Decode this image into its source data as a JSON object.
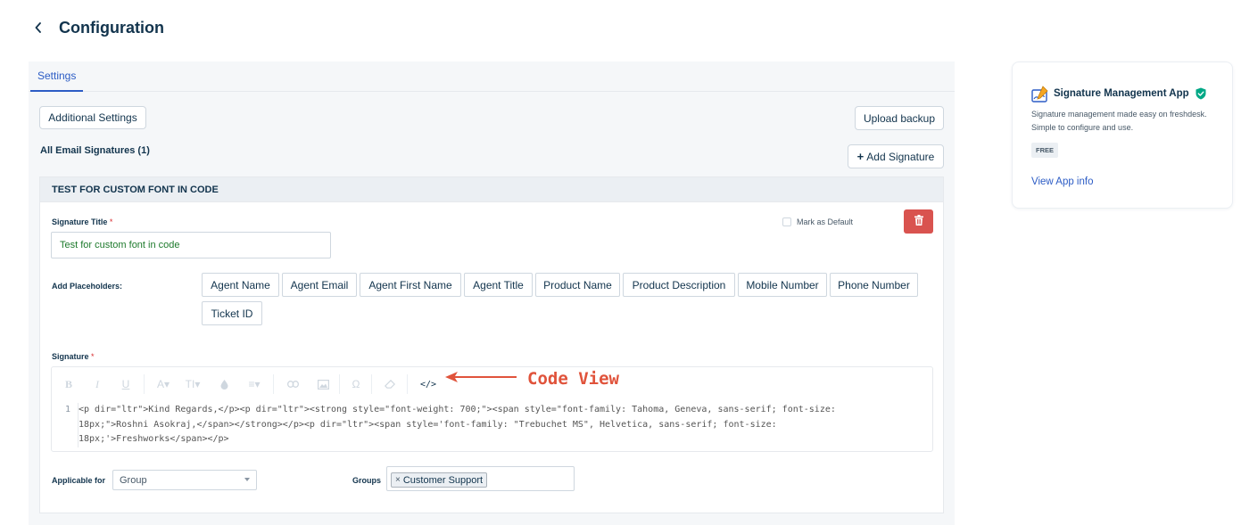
{
  "header": {
    "title": "Configuration"
  },
  "tabs": [
    {
      "label": "Settings",
      "active": true
    }
  ],
  "toolbar": {
    "additional_settings": "Additional Settings",
    "upload_backup": "Upload backup",
    "add_signature": "Add Signature",
    "plus": "+"
  },
  "signatures_heading": "All Email Signatures (1)",
  "signature_card": {
    "heading": "TEST FOR CUSTOM FONT IN CODE",
    "title_label": "Signature Title",
    "required_mark": "*",
    "title_value": "Test for custom font in code",
    "mark_default_label": "Mark as Default",
    "placeholders_label": "Add Placeholders:",
    "placeholders": [
      "Agent Name",
      "Agent Email",
      "Agent First Name",
      "Agent Title",
      "Product Name",
      "Product Description",
      "Mobile Number",
      "Phone Number",
      "Ticket ID"
    ],
    "signature_label": "Signature",
    "editor_tools": [
      "bold-icon",
      "italic-icon",
      "underline-icon",
      "font-color-icon",
      "text-size-icon",
      "fill-icon",
      "align-icon",
      "link-icon",
      "image-icon",
      "special-char-icon",
      "eraser-icon",
      "code-view-icon"
    ],
    "line_number": "1",
    "code_lines": [
      "<p dir=\"ltr\">Kind Regards,</p><p dir=\"ltr\"><strong style=\"font-weight: 700;\"><span style=\"font-family: Tahoma, Geneva, sans-serif; font-size:",
      "18px;\">Roshni Asokraj,</span></strong></p><p dir=\"ltr\"><span style='font-family: \"Trebuchet MS\", Helvetica, sans-serif; font-size:",
      "18px;'>Freshworks</span></p>"
    ],
    "applicable_label": "Applicable for",
    "applicable_value": "Group",
    "groups_label": "Groups",
    "group_chips": [
      "Customer Support"
    ],
    "chip_remove": "×"
  },
  "annotation": {
    "text": "Code View",
    "color": "#e0533b"
  },
  "app_card": {
    "name": "Signature Management App",
    "description": "Signature management made easy on freshdesk. Simple to configure and use.",
    "badge": "FREE",
    "link": "View App info"
  },
  "colors": {
    "accent": "#2c5cc5",
    "danger": "#d9534f",
    "verified": "#00a886",
    "text": "#12344d"
  }
}
